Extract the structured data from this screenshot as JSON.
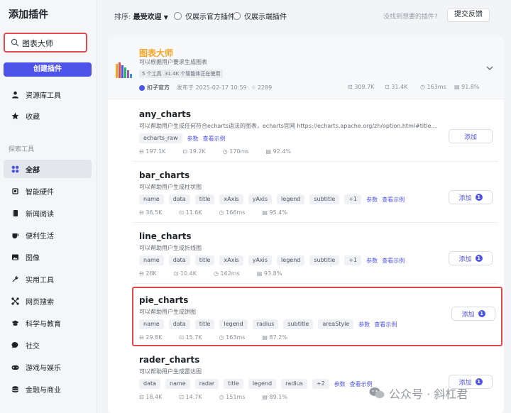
{
  "sidebar": {
    "title": "添加插件",
    "search": {
      "value": "图表大师",
      "placeholder": ""
    },
    "create_label": "创建插件",
    "top_items": [
      {
        "label": "资源库工具",
        "icon": "user-icon"
      },
      {
        "label": "收藏",
        "icon": "star-icon"
      }
    ],
    "section_label": "探索工具",
    "categories": [
      {
        "label": "全部",
        "icon": "grid-icon",
        "active": true
      },
      {
        "label": "智能硬件",
        "icon": "chip-icon"
      },
      {
        "label": "新闻阅读",
        "icon": "book-icon"
      },
      {
        "label": "便利生活",
        "icon": "cup-icon"
      },
      {
        "label": "图像",
        "icon": "image-icon"
      },
      {
        "label": "实用工具",
        "icon": "wrench-icon"
      },
      {
        "label": "网页搜索",
        "icon": "network-icon"
      },
      {
        "label": "科学与教育",
        "icon": "graduation-icon"
      },
      {
        "label": "社交",
        "icon": "chat-icon"
      },
      {
        "label": "游戏与娱乐",
        "icon": "gamepad-icon"
      },
      {
        "label": "金融与商业",
        "icon": "coins-icon"
      }
    ]
  },
  "topbar": {
    "sort_label": "排序:",
    "sort_value": "最受欢迎",
    "filter_official": "仅展示官方插件",
    "filter_device": "仅展示端插件",
    "hint": "没找到想要的插件?",
    "feedback_label": "提交反馈"
  },
  "featured": {
    "title": "图表大师",
    "desc": "可以根据用户要求生成图表",
    "tags": [
      "5 个工具",
      "31.4K 个智能体正在使用"
    ],
    "publisher": "扣子官方",
    "published": "发布于 2025-02-17 10:59",
    "favorites": "2289",
    "stats": [
      "309.7K",
      "31.4K",
      "163ms",
      "91.8%"
    ]
  },
  "plugins": [
    {
      "name": "any_charts",
      "desc": "可以帮助用户生成任何符合echarts语法的图表，echarts官网 https://echarts.apache.org/zh/option.html#title，不...",
      "params": [
        "echarts_raw"
      ],
      "link_params": "参数",
      "link_example": "查看示例",
      "stats": [
        "197.1K",
        "19.2K",
        "170ms",
        "92.4%"
      ],
      "add_label": "添加",
      "badge": ""
    },
    {
      "name": "bar_charts",
      "desc": "可以帮助用户生成柱状图",
      "params": [
        "name",
        "data",
        "title",
        "xAxis",
        "yAxis",
        "legend",
        "subtitle",
        "+1"
      ],
      "link_params": "参数",
      "link_example": "查看示例",
      "stats": [
        "36.5K",
        "11.6K",
        "166ms",
        "95.4%"
      ],
      "add_label": "添加",
      "badge": "1"
    },
    {
      "name": "line_charts",
      "desc": "可以帮助用户生成折线图",
      "params": [
        "name",
        "data",
        "title",
        "xAxis",
        "yAxis",
        "legend",
        "subtitle",
        "+1"
      ],
      "link_params": "参数",
      "link_example": "查看示例",
      "stats": [
        "28K",
        "10.4K",
        "162ms",
        "93.8%"
      ],
      "add_label": "添加",
      "badge": "1"
    },
    {
      "name": "pie_charts",
      "desc": "可以帮助用户生成饼图",
      "params": [
        "name",
        "data",
        "title",
        "legend",
        "radius",
        "subtitle",
        "areaStyle"
      ],
      "link_params": "参数",
      "link_example": "查看示例",
      "stats": [
        "29.8K",
        "15.7K",
        "163ms",
        "87.2%"
      ],
      "add_label": "添加",
      "badge": "1"
    },
    {
      "name": "rader_charts",
      "desc": "可以帮助用户生成雷达图",
      "params": [
        "data",
        "name",
        "radar",
        "title",
        "legend",
        "radius",
        "+2"
      ],
      "link_params": "参数",
      "link_example": "查看示例",
      "stats": [
        "18.4K",
        "14.7K",
        "151ms",
        "89.1%"
      ],
      "add_label": "添加",
      "badge": "1"
    }
  ],
  "watermark": "公众号 · 斜杠君",
  "colors": {
    "accent": "#4d53e8",
    "highlight": "#e5484d",
    "featured_title": "#f5a524"
  }
}
